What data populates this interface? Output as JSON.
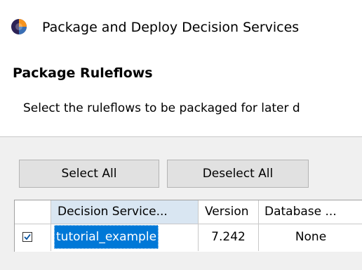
{
  "window": {
    "title": "Package and Deploy Decision Services",
    "icon": "eclipse-icon"
  },
  "page": {
    "heading": "Package Ruleflows",
    "description": "Select the ruleflows to be packaged for later d"
  },
  "buttons": {
    "select_all": "Select All",
    "deselect_all": "Deselect All"
  },
  "table": {
    "columns": [
      "",
      "Decision Service...",
      "Version",
      "Database ..."
    ],
    "rows": [
      {
        "checked": true,
        "name": "tutorial_example",
        "version": "7.242",
        "database": "None"
      }
    ]
  },
  "colors": {
    "selection": "#0078d7",
    "header_highlight": "#d9e6f2",
    "dialog_background": "#f0f0f0"
  }
}
